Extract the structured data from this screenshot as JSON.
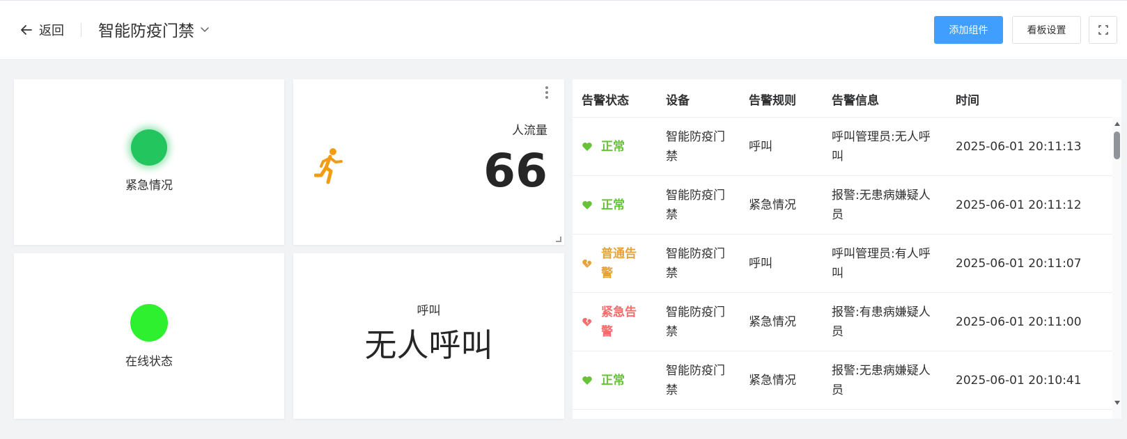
{
  "header": {
    "back_label": "返回",
    "board_title": "智能防疫门禁",
    "add_widget": "添加组件",
    "board_settings": "看板设置"
  },
  "widgets": {
    "emergency": {
      "label": "紧急情况",
      "indicator_color": "#22c55e"
    },
    "online": {
      "label": "在线状态",
      "indicator_color": "#2ef02e"
    },
    "flow": {
      "title": "人流量",
      "value": "66",
      "icon": "running-person-icon",
      "icon_color": "#f39c12"
    },
    "call": {
      "title": "呼叫",
      "value": "无人呼叫"
    }
  },
  "alarm_table": {
    "columns": [
      "告警状态",
      "设备",
      "告警规则",
      "告警信息",
      "时间"
    ],
    "status_colors": {
      "正常": "#67c23a",
      "普通告警": "#e6a23c",
      "紧急告警": "#f56c6c"
    },
    "rows": [
      {
        "status": "正常",
        "status_type": "normal",
        "device": "智能防疫门禁",
        "rule": "呼叫",
        "info": "呼叫管理员:无人呼叫",
        "time": "2025-06-01 20:11:13"
      },
      {
        "status": "正常",
        "status_type": "normal",
        "device": "智能防疫门禁",
        "rule": "紧急情况",
        "info": "报警:无患病嫌疑人员",
        "time": "2025-06-01 20:11:12"
      },
      {
        "status": "普通告警",
        "status_type": "warning",
        "device": "智能防疫门禁",
        "rule": "呼叫",
        "info": "呼叫管理员:有人呼叫",
        "time": "2025-06-01 20:11:07"
      },
      {
        "status": "紧急告警",
        "status_type": "danger",
        "device": "智能防疫门禁",
        "rule": "紧急情况",
        "info": "报警:有患病嫌疑人员",
        "time": "2025-06-01 20:11:00"
      },
      {
        "status": "正常",
        "status_type": "normal",
        "device": "智能防疫门禁",
        "rule": "紧急情况",
        "info": "报警:无患病嫌疑人员",
        "time": "2025-06-01 20:10:41"
      }
    ]
  }
}
